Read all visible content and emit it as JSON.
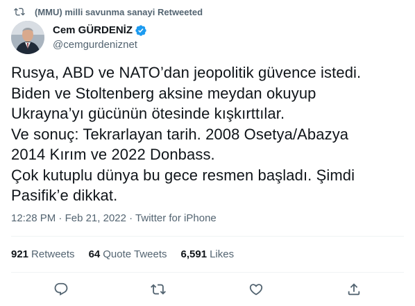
{
  "retweet_header": {
    "text": "(MMU) milli savunma sanayi Retweeted"
  },
  "author": {
    "name": "Cem GÜRDENİZ",
    "handle": "@cemgurdeniznet",
    "verified_color": "#1d9bf0"
  },
  "tweet": {
    "text": "Rusya, ABD ve NATO’dan jeopolitik güvence istedi.\nBiden ve Stoltenberg aksine meydan okuyup\nUkrayna’yı gücünün ötesinde kışkırttılar.\nVe sonuç: Tekrarlayan tarih. 2008 Osetya/Abazya\n2014 Kırım ve 2022 Donbass.\nÇok kutuplu dünya bu gece resmen başladı. Şimdi\nPasifik’e dikkat."
  },
  "meta": {
    "time": "12:28 PM",
    "sep1": "·",
    "date": "Feb 21, 2022",
    "sep2": "·",
    "source": "Twitter for iPhone"
  },
  "stats": {
    "retweets_count": "921",
    "retweets_label": "Retweets",
    "quotes_count": "64",
    "quotes_label": "Quote Tweets",
    "likes_count": "6,591",
    "likes_label": "Likes"
  },
  "actions": [
    "reply-icon",
    "retweet-icon",
    "like-icon",
    "share-icon"
  ],
  "colors": {
    "text": "#0f1419",
    "secondary": "#536471",
    "divider": "#eff3f4",
    "verified": "#1d9bf0"
  }
}
